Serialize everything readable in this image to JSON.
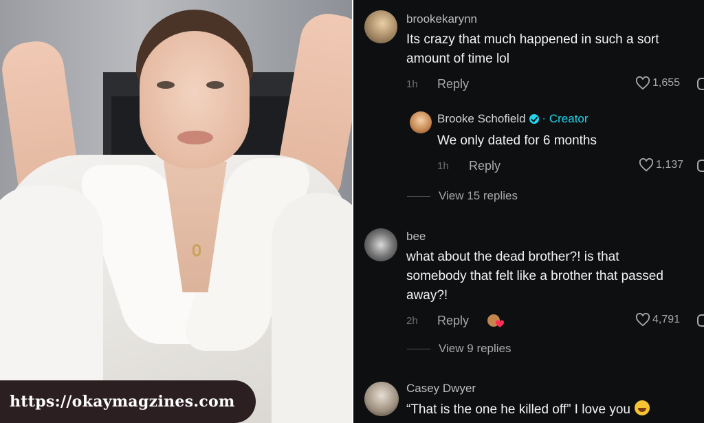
{
  "watermark": {
    "url": "https://okaymagzines.com"
  },
  "comments": [
    {
      "username": "brookekarynn",
      "text_lines": [
        "Its crazy that much happened in such a sort",
        "amount of time lol"
      ],
      "time": "1h",
      "reply_label": "Reply",
      "likes": "1,655"
    },
    {
      "username": "Brooke Schofield",
      "badge": "Creator",
      "text_lines": [
        "We only dated for 6 months"
      ],
      "time": "1h",
      "reply_label": "Reply",
      "likes": "1,137"
    },
    {
      "username": "bee",
      "text_lines": [
        "what about the dead brother?! is that",
        "somebody that felt like a brother that passed",
        "away?!"
      ],
      "time": "2h",
      "reply_label": "Reply",
      "likes": "4,791"
    },
    {
      "username": "Casey Dwyer",
      "text_lines": [
        "“That is the one he killed off” I love you"
      ]
    }
  ],
  "view_replies": [
    "View 15 replies",
    "View 9 replies"
  ],
  "colors": {
    "background": "#0e0f11",
    "creator_accent": "#20d5ec",
    "text": "#f4f4f4",
    "muted": "#a9a9a9"
  },
  "icons": [
    "heart-icon",
    "verified-badge-icon",
    "laughing-emoji-icon"
  ]
}
